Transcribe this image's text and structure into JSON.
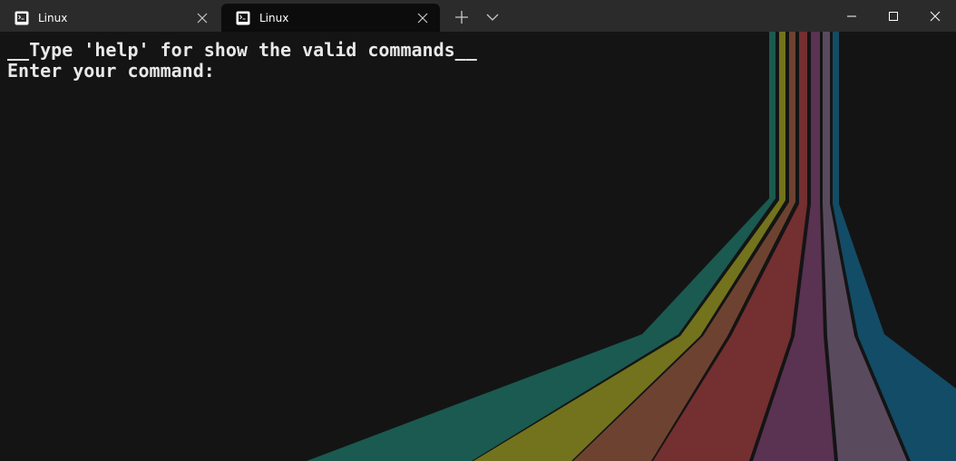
{
  "tabs": [
    {
      "title": "Linux",
      "active": false
    },
    {
      "title": "Linux",
      "active": true
    }
  ],
  "icons": {
    "tab": "terminal-icon",
    "tab_close": "close-icon",
    "new_tab": "plus-icon",
    "dropdown": "chevron-down-icon",
    "minimize": "minimize-icon",
    "maximize": "maximize-icon",
    "close": "close-icon"
  },
  "terminal": {
    "lines": [
      "__Type 'help' for show the valid commands__",
      "Enter your command:"
    ]
  },
  "colors": {
    "background": "#141414",
    "titlebar": "#2b2b2b",
    "active_tab": "#0c0c0c",
    "text": "#e8e8e8",
    "stripes": [
      "#1a5a50",
      "#72731c",
      "#6e4230",
      "#742f30",
      "#5a3252",
      "#5a4a5e",
      "#134c66"
    ]
  }
}
